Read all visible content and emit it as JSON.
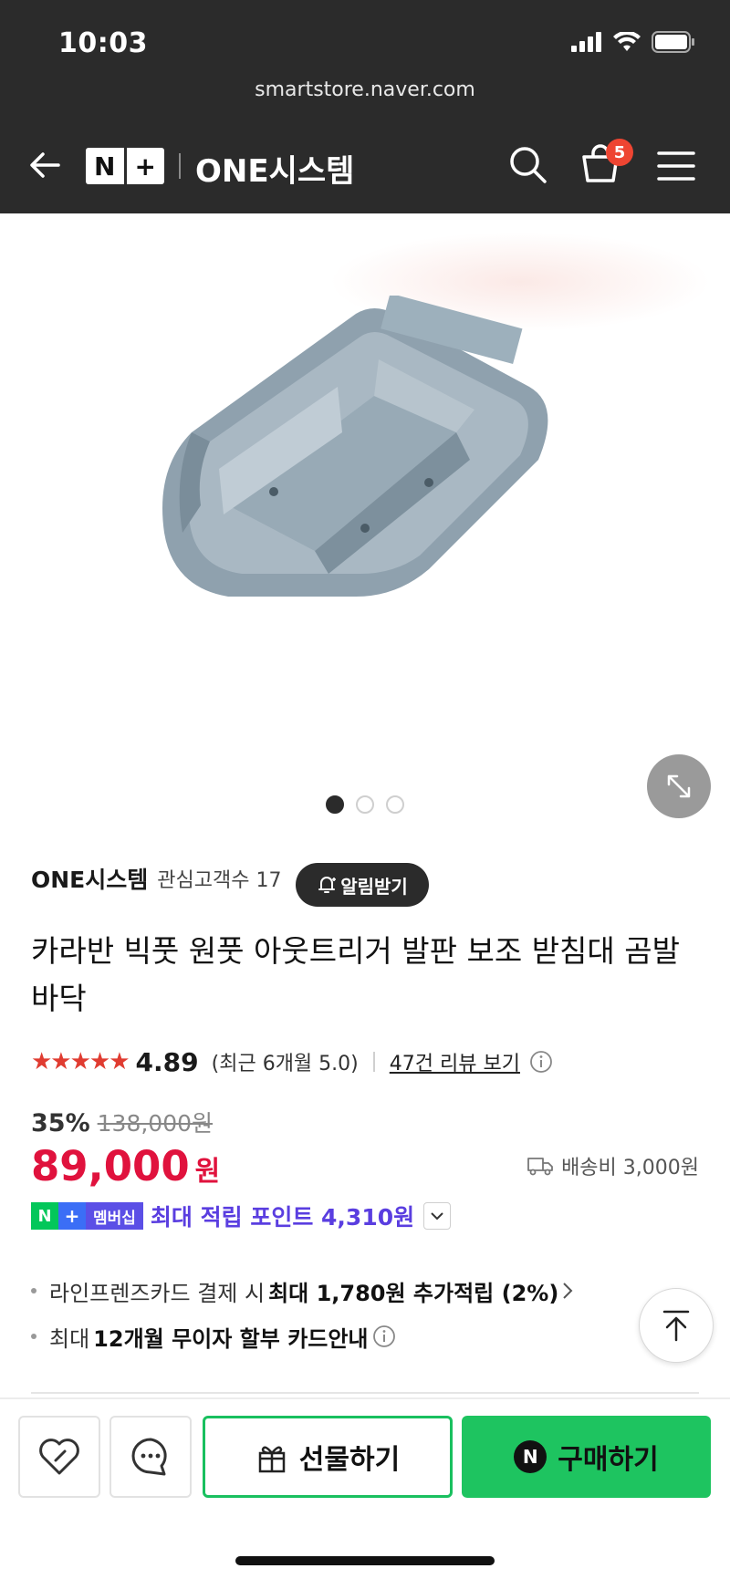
{
  "status": {
    "time": "10:03"
  },
  "browser": {
    "url": "smartstore.naver.com"
  },
  "nav": {
    "brand_left": "N",
    "brand_right": "+",
    "store_name": "ONE시스템",
    "cart_count": "5",
    "icons": [
      "back-arrow-icon",
      "search-icon",
      "cart-icon",
      "menu-icon"
    ]
  },
  "gallery": {
    "total": 3,
    "active": 1
  },
  "seller": {
    "name": "ONE시스템",
    "interest": "관심고객수 17",
    "alarm_label": "알림받기"
  },
  "product": {
    "title": "카라반 빅풋 원풋 아웃트리거 발판 보조 받침대 곰발바닥",
    "stars": "★★★★★",
    "rating": "4.89",
    "recent_rating": "(최근 6개월 5.0)",
    "review_link": "47건 리뷰 보기",
    "discount": "35%",
    "original_price": "138,000원",
    "price": "89,000",
    "price_unit": "원",
    "shipping": "배송비 3,000원"
  },
  "membership": {
    "badge_n": "N",
    "badge_plus": "+",
    "badge_label": "멤버십",
    "point_text": "최대 적립 포인트 4,310원"
  },
  "benefits": {
    "card_pre": "라인프렌즈카드 결제 시",
    "card_bold": "최대 1,780원 추가적립 (2%)",
    "install_pre": "최대",
    "install_bold": "12개월 무이자 할부 카드안내"
  },
  "actions": {
    "gift_label": "선물하기",
    "buy_n": "N",
    "buy_label": "구매하기"
  },
  "colors": {
    "price_red": "#e0123d",
    "naver_green": "#1ec460",
    "member_purple": "#5a3ee0",
    "badge_red": "#ee4532"
  }
}
